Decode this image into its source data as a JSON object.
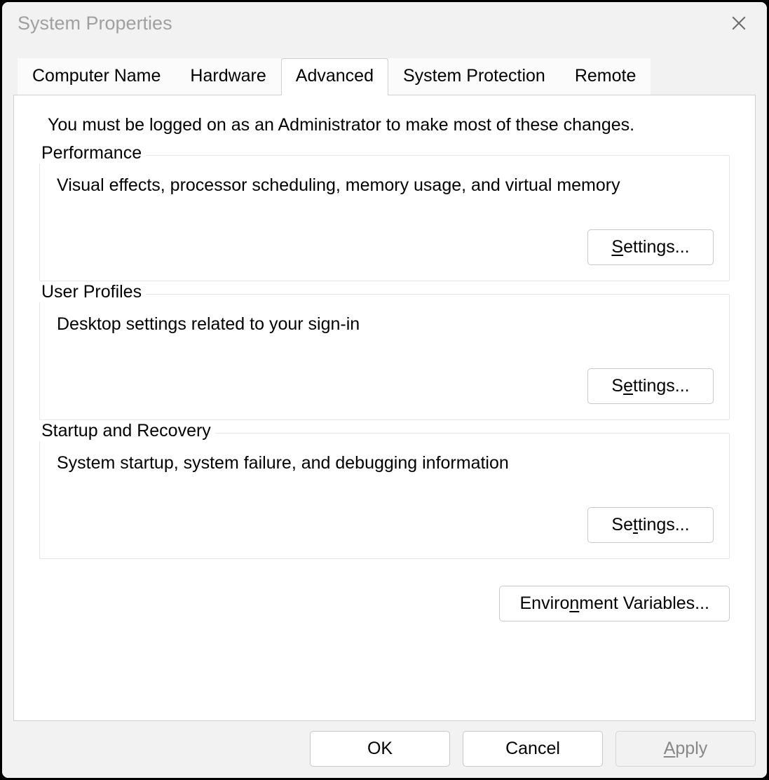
{
  "window": {
    "title": "System Properties"
  },
  "tabs": {
    "computer_name": "Computer Name",
    "hardware": "Hardware",
    "advanced": "Advanced",
    "system_protection": "System Protection",
    "remote": "Remote"
  },
  "intro": "You must be logged on as an Administrator to make most of these changes.",
  "groups": {
    "performance": {
      "label": "Performance",
      "desc": "Visual effects, processor scheduling, memory usage, and virtual memory",
      "button_pre": "",
      "button_accel": "S",
      "button_post": "ettings..."
    },
    "user_profiles": {
      "label": "User Profiles",
      "desc": "Desktop settings related to your sign-in",
      "button_pre": "S",
      "button_accel": "e",
      "button_post": "ttings..."
    },
    "startup": {
      "label": "Startup and Recovery",
      "desc": "System startup, system failure, and debugging information",
      "button_pre": "Se",
      "button_accel": "t",
      "button_post": "tings..."
    }
  },
  "env": {
    "pre": "Enviro",
    "accel": "n",
    "post": "ment Variables..."
  },
  "buttons": {
    "ok": "OK",
    "cancel": "Cancel",
    "apply_pre": "",
    "apply_accel": "A",
    "apply_post": "pply"
  }
}
